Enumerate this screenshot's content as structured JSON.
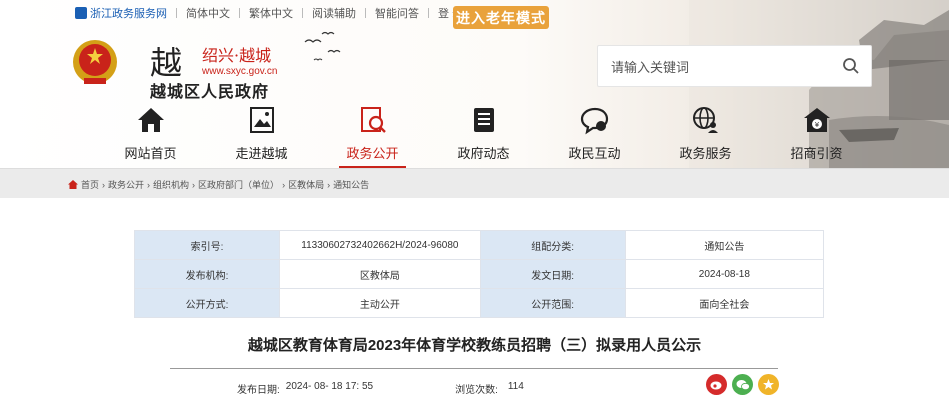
{
  "topbar": {
    "gov_link": "浙江政务服务网",
    "items": [
      "简体中文",
      "繁体中文",
      "阅读辅助",
      "智能问答",
      "登 录"
    ],
    "elder_mode": "进入老年模式"
  },
  "logo": {
    "char": "越",
    "city": "绍兴·越城",
    "url": "www.sxyc.gov.cn",
    "name": "越城区人民政府"
  },
  "search": {
    "placeholder": "请输入关键词"
  },
  "nav": {
    "items": [
      {
        "label": "网站首页",
        "icon": "home-icon"
      },
      {
        "label": "走进越城",
        "icon": "picture-icon"
      },
      {
        "label": "政务公开",
        "icon": "document-search-icon"
      },
      {
        "label": "政府动态",
        "icon": "news-icon"
      },
      {
        "label": "政民互动",
        "icon": "chat-icon"
      },
      {
        "label": "政务服务",
        "icon": "globe-user-icon"
      },
      {
        "label": "招商引资",
        "icon": "money-house-icon"
      }
    ],
    "active_index": 2
  },
  "breadcrumb": {
    "items": [
      "首页",
      "政务公开",
      "组织机构",
      "区政府部门（单位）",
      "区教体局",
      "通知公告"
    ],
    "separator": "›"
  },
  "meta": {
    "index_label": "索引号:",
    "index_value": "11330602732402662H/2024-96080",
    "category_label": "组配分类:",
    "category_value": "通知公告",
    "org_label": "发布机构:",
    "org_value": "区教体局",
    "date_label": "发文日期:",
    "date_value": "2024-08-18",
    "mode_label": "公开方式:",
    "mode_value": "主动公开",
    "scope_label": "公开范围:",
    "scope_value": "面向全社会"
  },
  "article": {
    "title": "越城区教育体育局2023年体育学校教练员招聘（三）拟录用人员公示",
    "publish_label": "发布日期:",
    "publish_value": "2024- 08- 18 17: 55",
    "views_label": "浏览次数:",
    "views_value": "114"
  },
  "share": [
    {
      "icon": "weibo-icon",
      "color": "#d52b2b"
    },
    {
      "icon": "wechat-icon",
      "color": "#4caf50"
    },
    {
      "icon": "qzone-icon",
      "color": "#f0b429"
    }
  ],
  "colors": {
    "accent": "#c9231a",
    "elder": "#e9a23b",
    "meta_key_bg": "#dbe7f4"
  }
}
